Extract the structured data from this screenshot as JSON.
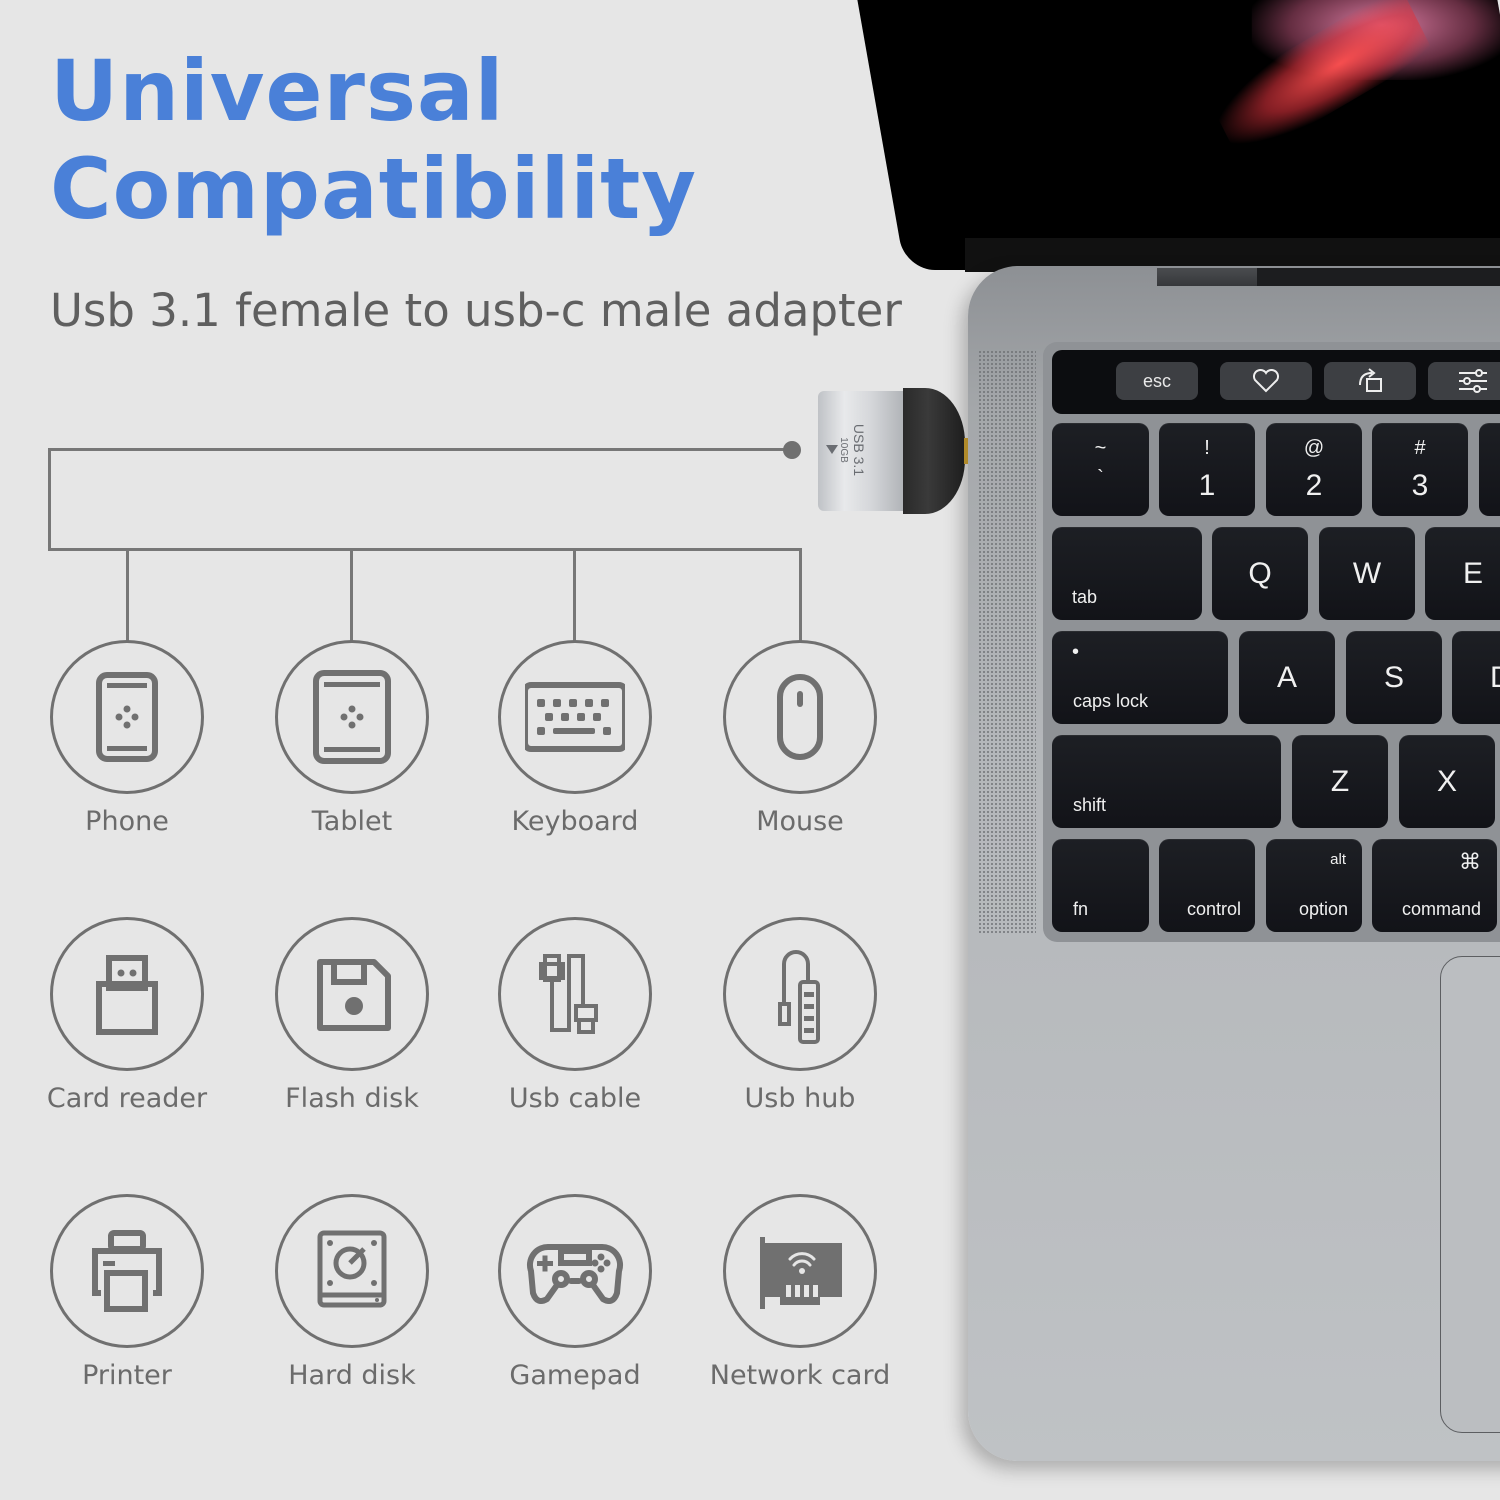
{
  "header": {
    "title_line1": "Universal",
    "title_line2": "Compatibility",
    "subtitle": "Usb 3.1 female to usb-c male adapter",
    "title_color": "#4a80d8"
  },
  "adapter": {
    "label_main": "USB 3.1",
    "label_speed": "10GB"
  },
  "devices": [
    {
      "label": "Phone",
      "icon": "phone-icon"
    },
    {
      "label": "Tablet",
      "icon": "tablet-icon"
    },
    {
      "label": "Keyboard",
      "icon": "keyboard-icon"
    },
    {
      "label": "Mouse",
      "icon": "mouse-icon"
    },
    {
      "label": "Card reader",
      "icon": "card-reader-icon"
    },
    {
      "label": "Flash disk",
      "icon": "flash-disk-icon"
    },
    {
      "label": "Usb cable",
      "icon": "usb-cable-icon"
    },
    {
      "label": "Usb hub",
      "icon": "usb-hub-icon"
    },
    {
      "label": "Printer",
      "icon": "printer-icon"
    },
    {
      "label": "Hard disk",
      "icon": "hard-disk-icon"
    },
    {
      "label": "Gamepad",
      "icon": "gamepad-icon"
    },
    {
      "label": "Network card",
      "icon": "network-card-icon"
    }
  ],
  "laptop": {
    "touchbar": {
      "esc": "esc",
      "icons": [
        "heart-icon",
        "rotate-icon",
        "sliders-icon"
      ]
    },
    "keys": {
      "tilde_top": "~",
      "tilde_main": "`",
      "k1_top": "!",
      "k1_main": "1",
      "k2_top": "@",
      "k2_main": "2",
      "k3_top": "#",
      "k3_main": "3",
      "tab": "tab",
      "q": "Q",
      "w": "W",
      "e": "E",
      "caps_dot": "•",
      "caps": "caps lock",
      "a": "A",
      "s": "S",
      "d": "D",
      "shift": "shift",
      "z": "Z",
      "x": "X",
      "fn": "fn",
      "control": "control",
      "alt": "alt",
      "option": "option",
      "cmd_symbol": "⌘",
      "command": "command"
    }
  }
}
